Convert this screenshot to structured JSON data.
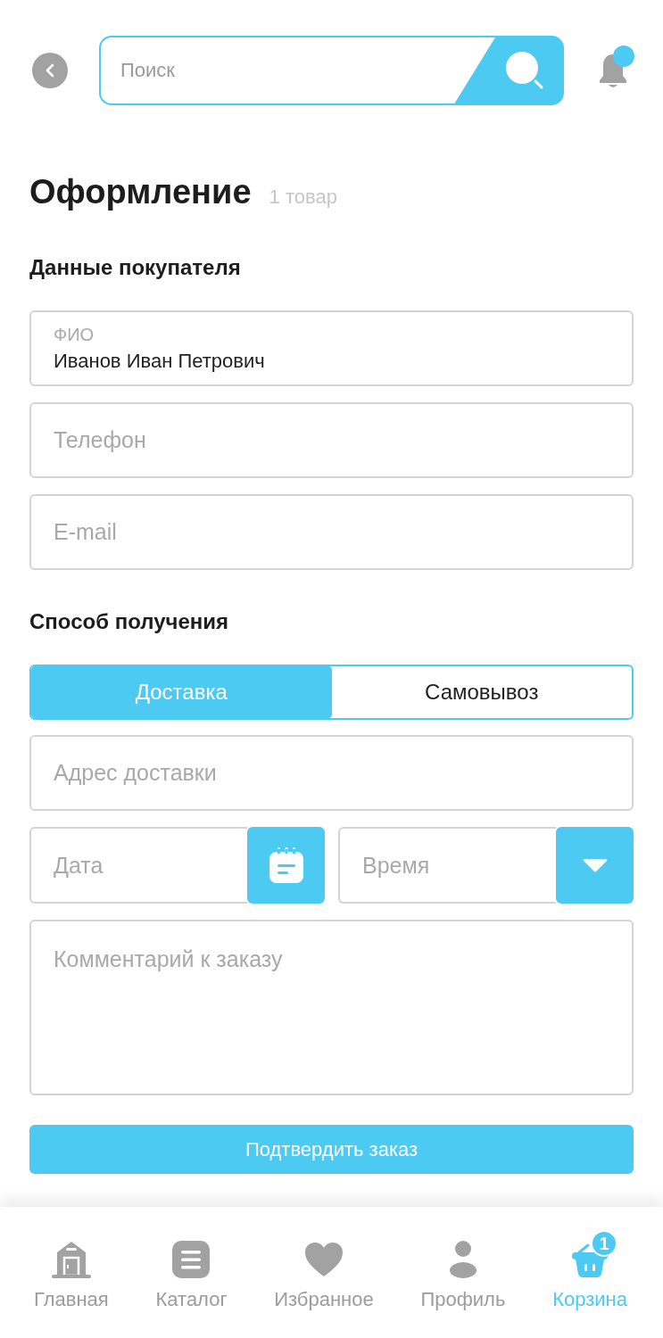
{
  "header": {
    "search": {
      "placeholder": "Поиск"
    },
    "notifications": {
      "unread": true
    }
  },
  "title": "Оформление",
  "item_count": "1 товар",
  "buyer": {
    "heading": "Данные покупателя",
    "fields": [
      {
        "kind": "labeled",
        "label": "ФИО",
        "value": "Иванов Иван Петрович"
      },
      {
        "kind": "plain",
        "placeholder": "Телефон"
      },
      {
        "kind": "plain",
        "placeholder": "E-mail"
      }
    ]
  },
  "delivery": {
    "heading": "Способ получения",
    "options": [
      {
        "label": "Доставка",
        "selected": true
      },
      {
        "label": "Самовывоз",
        "selected": false
      }
    ],
    "address": {
      "placeholder": "Адрес доставки"
    },
    "date": {
      "placeholder": "Дата"
    },
    "time": {
      "placeholder": "Время"
    },
    "comment": {
      "placeholder": "Комментарий к заказу"
    }
  },
  "confirm_button": "Подтвердить заказ",
  "nav": [
    {
      "kind": "home",
      "label": "Главная",
      "selected": false
    },
    {
      "kind": "catalog",
      "label": "Каталог",
      "selected": false
    },
    {
      "kind": "favorites",
      "label": "Избранное",
      "selected": false
    },
    {
      "kind": "profile",
      "label": "Профиль",
      "selected": false
    },
    {
      "kind": "cart",
      "label": "Корзина",
      "selected": true,
      "badge": "1"
    }
  ]
}
